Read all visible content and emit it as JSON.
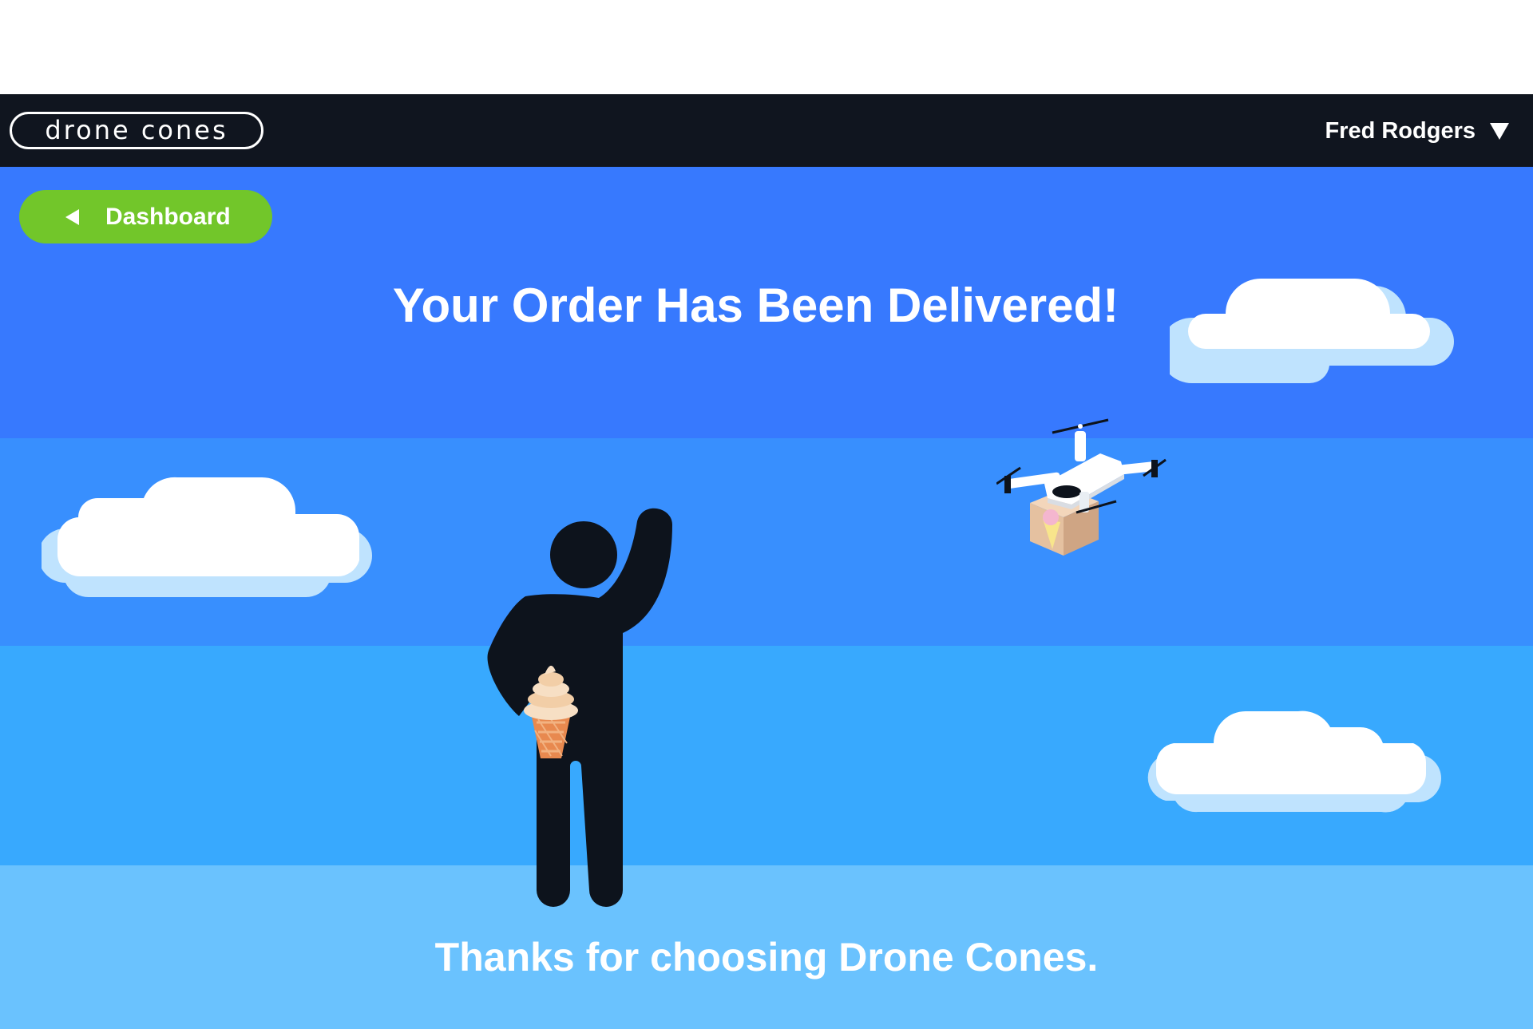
{
  "header": {
    "logo_text": "drone cones",
    "user_name": "Fred Rodgers",
    "user_menu_icon": "caret-down-icon"
  },
  "nav": {
    "back_label": "Dashboard",
    "back_icon": "triangle-left-icon"
  },
  "main": {
    "headline": "Your Order Has Been Delivered!",
    "thanks": "Thanks for choosing Drone Cones."
  },
  "colors": {
    "navbar": "#10151f",
    "sky_band_1": "#3779fe",
    "sky_band_2": "#388ffe",
    "sky_band_3": "#38a9fe",
    "sky_band_4": "#6ac2fe",
    "accent_green": "#72c62a",
    "figure": "#0d131c"
  }
}
